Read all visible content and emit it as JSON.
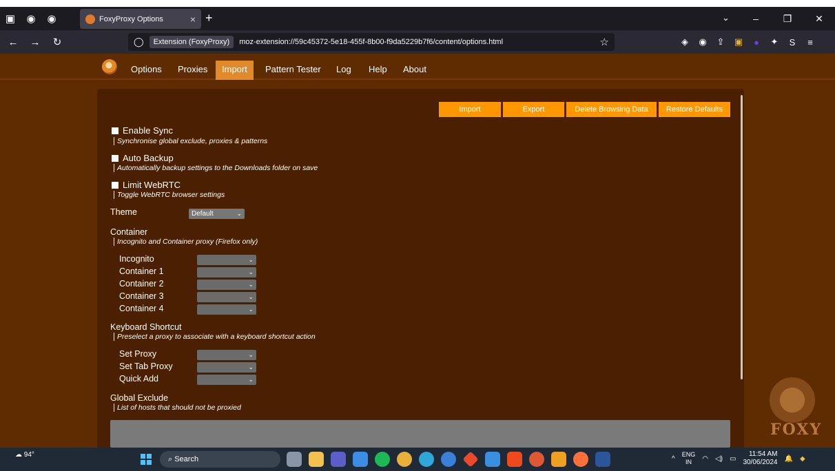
{
  "browser": {
    "tab_title": "FoxyProxy Options",
    "tab_close": "×",
    "new_tab": "+",
    "url_chip": "Extension (FoxyProxy)",
    "url": "moz-extension://59c45372-5e18-455f-8b00-f9da5229b7f6/content/options.html"
  },
  "ext_nav": {
    "tabs": [
      "Options",
      "Proxies",
      "Import",
      "Pattern Tester",
      "Log",
      "Help",
      "About"
    ],
    "active": "Import"
  },
  "actions": {
    "import": "Import",
    "export": "Export",
    "delete_browsing_data": "Delete Browsing Data",
    "restore_defaults": "Restore Defaults"
  },
  "options": {
    "enable_sync": {
      "label": "Enable Sync",
      "desc": "Synchronise global exclude, proxies & patterns",
      "checked": false
    },
    "auto_backup": {
      "label": "Auto Backup",
      "desc": "Automatically backup settings to the Downloads folder on save",
      "checked": false
    },
    "limit_webrtc": {
      "label": "Limit WebRTC",
      "desc": "Toggle WebRTC browser settings",
      "checked": false
    },
    "theme": {
      "label": "Theme",
      "value": "Default"
    },
    "container": {
      "label": "Container",
      "desc": "Incognito and Container proxy (Firefox only)",
      "rows": [
        "Incognito",
        "Container 1",
        "Container 2",
        "Container 3",
        "Container 4"
      ]
    },
    "keyboard": {
      "label": "Keyboard Shortcut",
      "desc": "Preselect a proxy to associate with a keyboard shortcut action",
      "rows": [
        "Set Proxy",
        "Set Tab Proxy",
        "Quick Add"
      ]
    },
    "global_exclude": {
      "label": "Global Exclude",
      "desc": "List of hosts that should not be proxied"
    }
  },
  "watermark": "FOXY",
  "taskbar": {
    "weather": "94°",
    "search": "Search",
    "lang_top": "ENG",
    "lang_bottom": "IN",
    "time": "11:54 AM",
    "date": "30/06/2024"
  },
  "colors": {
    "page_bg": "#5f2b00",
    "card_bg": "#4a2000",
    "accent": "#ff9800",
    "active_tab": "#e08a2a"
  }
}
